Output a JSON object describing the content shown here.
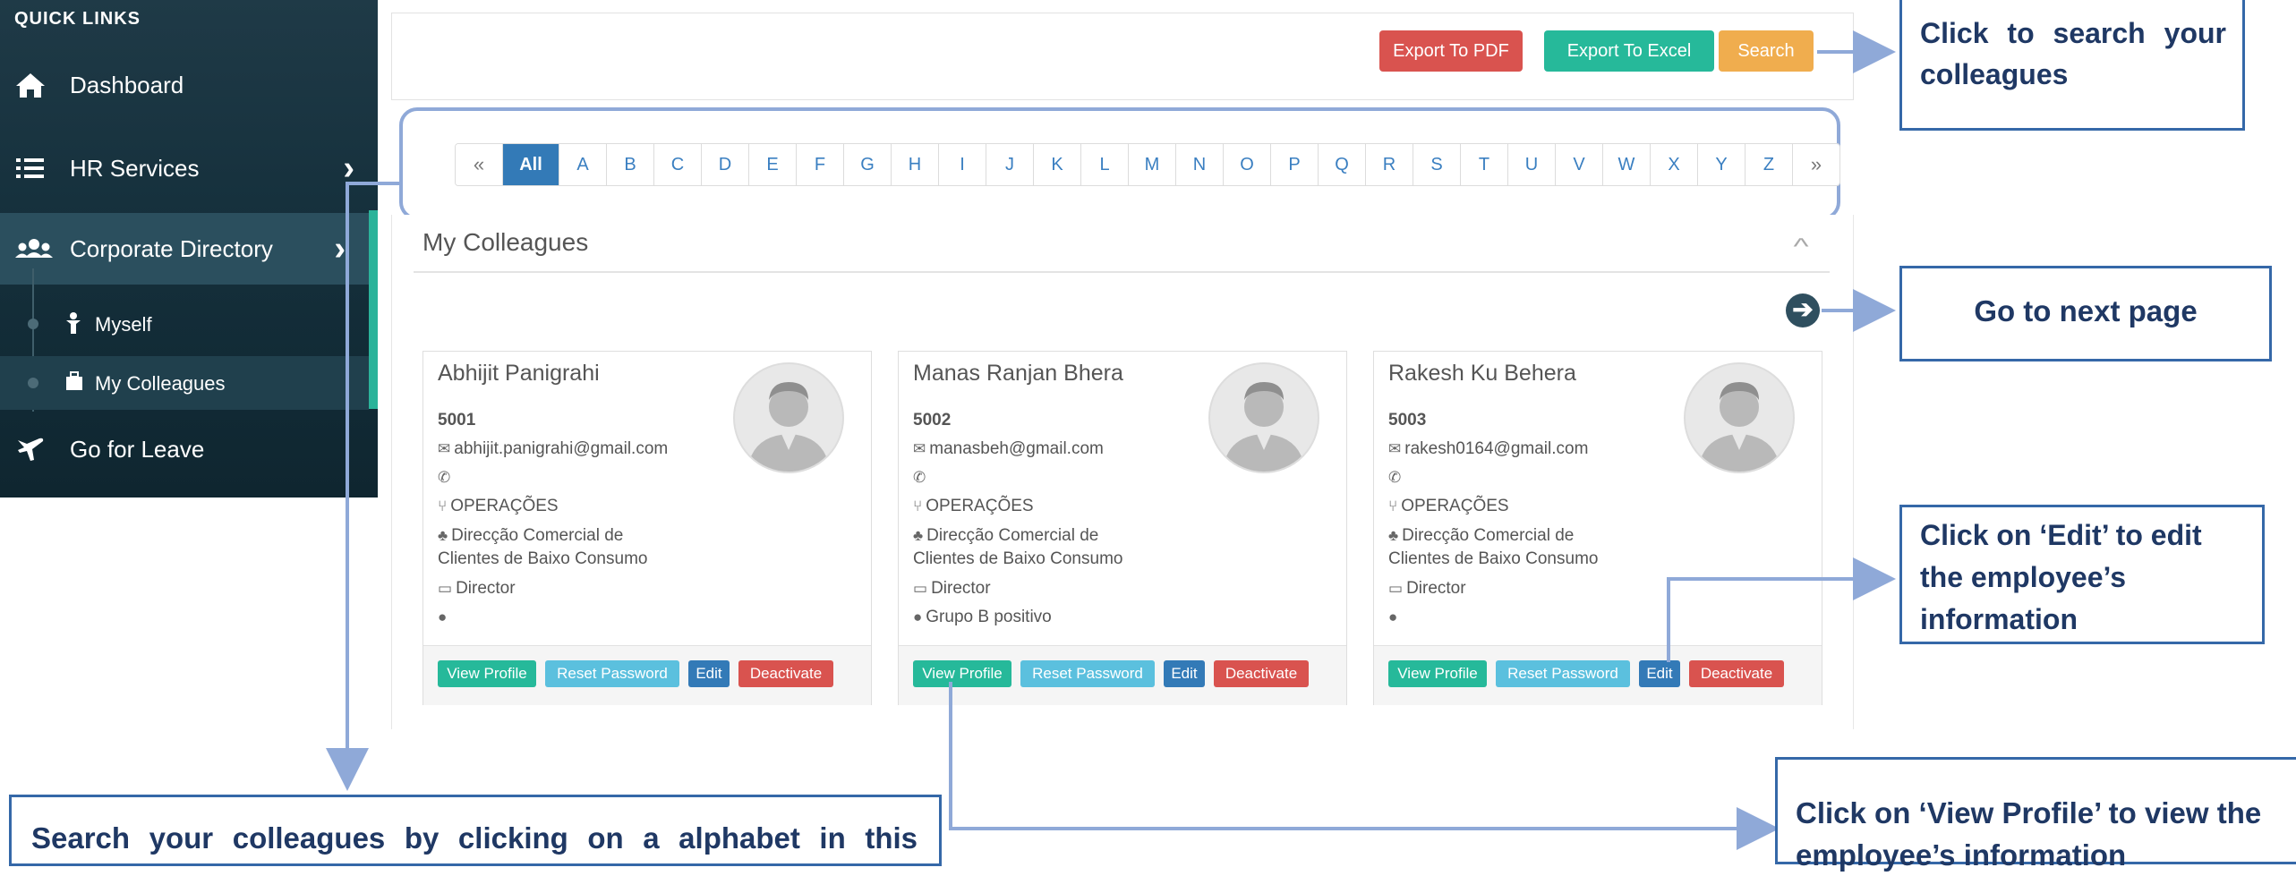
{
  "sidebar": {
    "title": "QUICK LINKS",
    "items": [
      {
        "label": "Dashboard",
        "icon": "home-icon"
      },
      {
        "label": "HR Services",
        "icon": "list-icon"
      },
      {
        "label": "Corporate Directory",
        "icon": "users-icon"
      },
      {
        "label": "Go for Leave",
        "icon": "plane-icon"
      }
    ],
    "sub_items": [
      {
        "label": "Myself",
        "icon": "person-icon"
      },
      {
        "label": "My Colleagues",
        "icon": "briefcase-icon"
      }
    ]
  },
  "toolbar": {
    "export_pdf": "Export To PDF",
    "export_excel": "Export To Excel",
    "search": "Search"
  },
  "alphabet": [
    "«",
    "All",
    "A",
    "B",
    "C",
    "D",
    "E",
    "F",
    "G",
    "H",
    "I",
    "J",
    "K",
    "L",
    "M",
    "N",
    "O",
    "P",
    "Q",
    "R",
    "S",
    "T",
    "U",
    "V",
    "W",
    "X",
    "Y",
    "Z",
    "»"
  ],
  "alphabet_active": "All",
  "section": {
    "title": "My Colleagues",
    "collapse_icon": "chevron-up-icon",
    "next_icon": "arrow-circle-right-icon"
  },
  "cards": [
    {
      "name": "Abhijit Panigrahi",
      "id": "5001",
      "email": "abhijit.panigrahi@gmail.com",
      "phone": "",
      "department": "OPERAÇÕES",
      "division_line1": "Direcção Comercial de",
      "division_line2": "Clientes de Baixo Consumo",
      "position": "Director",
      "blood": ""
    },
    {
      "name": "Manas Ranjan Bhera",
      "id": "5002",
      "email": "manasbeh@gmail.com",
      "phone": "",
      "department": "OPERAÇÕES",
      "division_line1": "Direcção Comercial de",
      "division_line2": "Clientes de Baixo Consumo",
      "position": "Director",
      "blood": "Grupo B positivo"
    },
    {
      "name": "Rakesh Ku Behera",
      "id": "5003",
      "email": "rakesh0164@gmail.com",
      "phone": "",
      "department": "OPERAÇÕES",
      "division_line1": "Direcção Comercial de",
      "division_line2": "Clientes de Baixo Consumo",
      "position": "Director",
      "blood": ""
    }
  ],
  "card_buttons": {
    "view_profile": "View Profile",
    "reset_password": "Reset Password",
    "edit": "Edit",
    "deactivate": "Deactivate"
  },
  "callouts": {
    "search": "Click to search your colleagues",
    "next_page": "Go to next page",
    "edit": "Click on ‘Edit’ to edit the employee’s information",
    "view_profile": "Click on ‘View Profile’ to view the employee’s information",
    "alphabet": "Search your colleagues by clicking on a alphabet in this"
  },
  "colors": {
    "sidebar_bg": "#1f3a47",
    "accent_green": "#26b99a",
    "accent_blue": "#5bc0de",
    "primary": "#337ab7",
    "danger": "#d9534f",
    "warning": "#f0ad4e",
    "callout_border": "#3568a8",
    "arrow": "#8fa9d8"
  }
}
